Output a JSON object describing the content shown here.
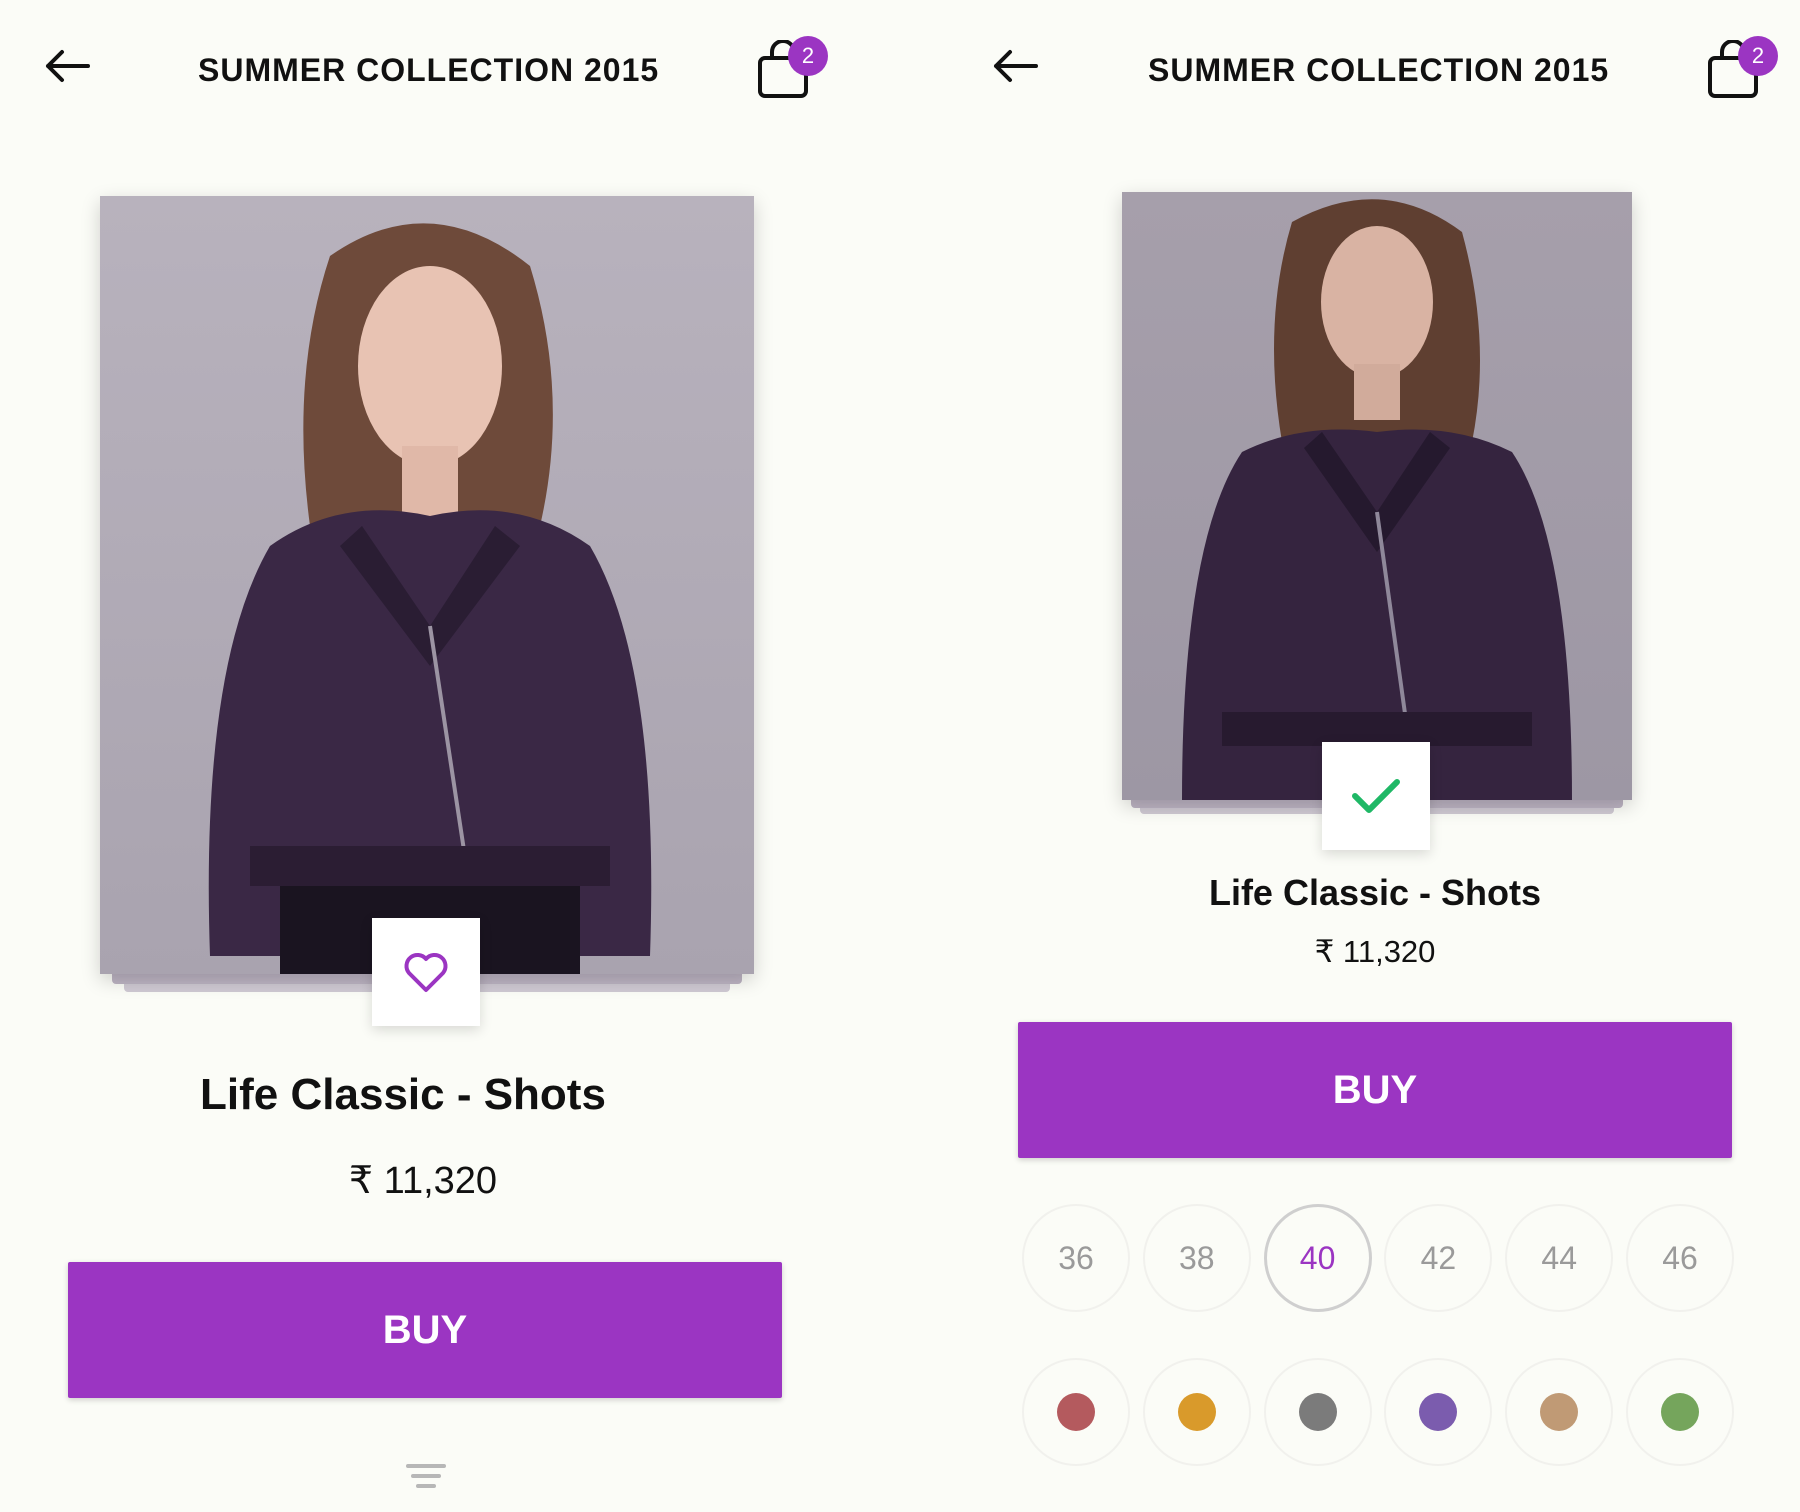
{
  "app": {
    "collection_title": "SUMMER COLLECTION 2015",
    "cart_count": "2",
    "accent_color": "#9b35c2"
  },
  "left_screen": {
    "product_name": "Life Classic - Shots",
    "price": "₹ 11,320",
    "buy_label": "BUY",
    "wishlist_icon": "heart-outline-icon",
    "menu_icon": "lines-menu-icon"
  },
  "right_screen": {
    "product_name": "Life Classic - Shots",
    "price": "₹ 11,320",
    "buy_label": "BUY",
    "added_icon": "checkmark-icon",
    "sizes": [
      "36",
      "38",
      "40",
      "42",
      "44",
      "46"
    ],
    "selected_size": "40",
    "colors": [
      "#b45a5e",
      "#d99a2b",
      "#7b7b7b",
      "#7b5cae",
      "#c09a75",
      "#75a55c"
    ]
  }
}
